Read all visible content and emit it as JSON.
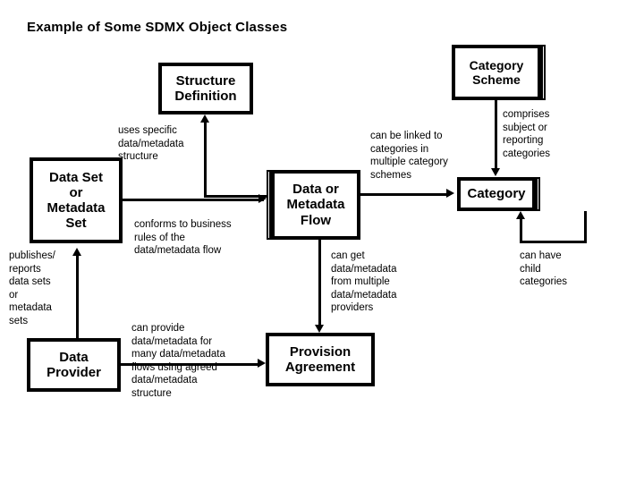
{
  "title": "Example of Some SDMX Object Classes",
  "nodes": {
    "structure_definition": "Structure\nDefinition",
    "category_scheme": "Category\nScheme",
    "data_set_or_metadata_set": "Data Set\nor\nMetadata\nSet",
    "data_or_metadata_flow": "Data or\nMetadata\nFlow",
    "category": "Category",
    "data_provider": "Data\nProvider",
    "provision_agreement": "Provision\nAgreement"
  },
  "edge_labels": {
    "uses_specific_structure": "uses specific\ndata/metadata\nstructure",
    "conforms_to_business_rules": "conforms to business\nrules of the\ndata/metadata flow",
    "publishes_reports": "publishes/\nreports\ndata sets\nor\nmetadata\nsets",
    "can_provide": "can provide\ndata/metadata for\nmany data/metadata\nflows using agreed\ndata/metadata\nstructure",
    "can_get_from_providers": "can get\ndata/metadata\nfrom multiple\ndata/metadata\nproviders",
    "can_be_linked": "can be linked to\ncategories in\nmultiple category\nschemes",
    "comprises": "comprises\nsubject or\nreporting\ncategories",
    "can_have_child": "can have\nchild\ncategories"
  },
  "colors": {
    "stroke": "#000000",
    "fill": "#ffffff",
    "text": "#000000"
  }
}
